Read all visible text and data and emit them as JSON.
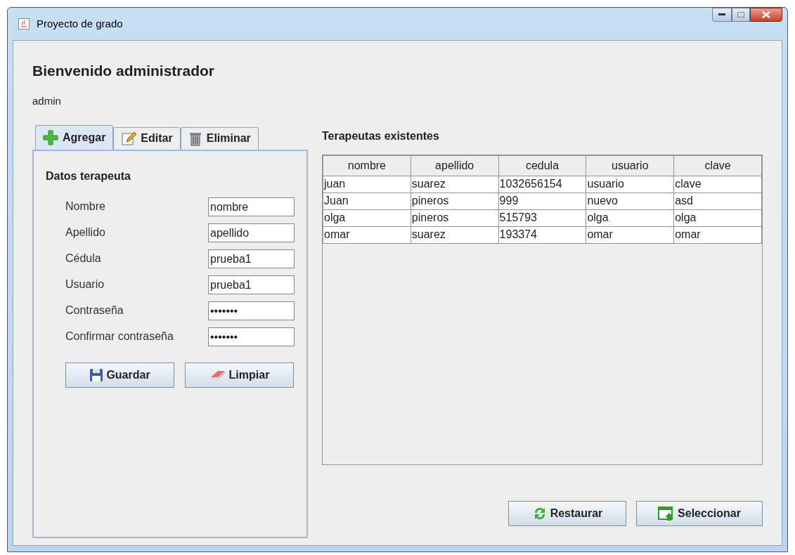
{
  "window": {
    "title": "Proyecto de grado"
  },
  "heading": "Bienvenido administrador",
  "username": "admin",
  "tabs": [
    {
      "label": "Agregar",
      "selected": true
    },
    {
      "label": "Editar",
      "selected": false
    },
    {
      "label": "Eliminar",
      "selected": false
    }
  ],
  "form": {
    "title": "Datos terapeuta",
    "fields": [
      {
        "label": "Nombre",
        "value": "nombre"
      },
      {
        "label": "Apellido",
        "value": "apellido"
      },
      {
        "label": "Cédula",
        "value": "prueba1"
      },
      {
        "label": "Usuario",
        "value": "prueba1"
      },
      {
        "label": "Contraseña",
        "value": "•••••••"
      },
      {
        "label": "Confirmar contraseña",
        "value": "•••••••"
      }
    ],
    "buttons": [
      "Guardar",
      "Limpiar"
    ]
  },
  "table": {
    "title": "Terapeutas existentes",
    "columns": [
      "nombre",
      "apellido",
      "cedula",
      "usuario",
      "clave"
    ],
    "rows": [
      [
        "juan",
        "suarez",
        "1032656154",
        "usuario",
        "clave"
      ],
      [
        "Juan",
        "pineros",
        "999",
        "nuevo",
        "asd"
      ],
      [
        "olga",
        "pineros",
        "515793",
        "olga",
        "olga"
      ],
      [
        "omar",
        "suarez",
        "193374",
        "omar",
        "omar"
      ]
    ]
  },
  "buttons": [
    "Restaurar",
    "Seleccionar"
  ]
}
